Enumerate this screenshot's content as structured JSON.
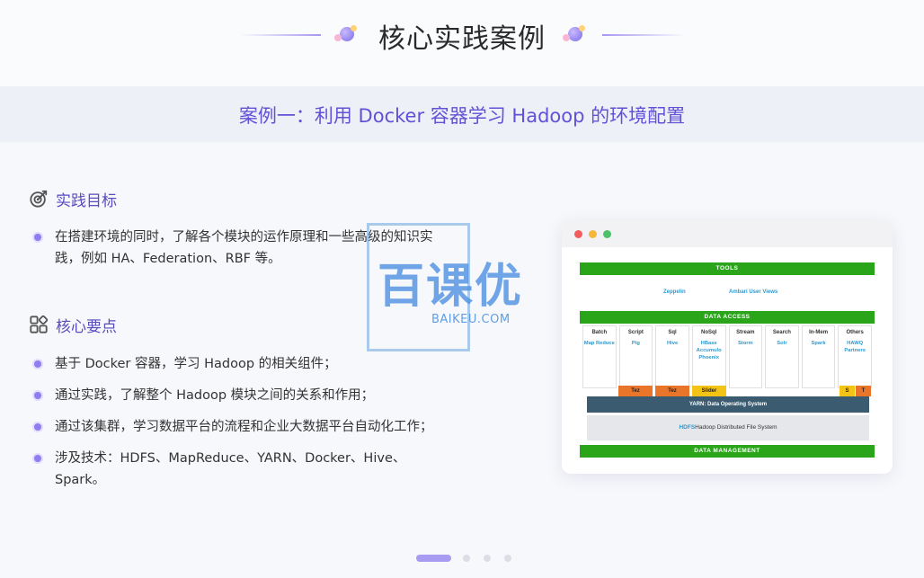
{
  "page": {
    "title": "核心实践案例",
    "subtitle": "案例一：利用 Docker 容器学习 Hadoop 的环境配置"
  },
  "goal_section": {
    "title": "实践目标",
    "icon": "target-icon",
    "items": [
      "在搭建环境的同时，了解各个模块的运作原理和一些高级的知识实践，例如 HA、Federation、RBF 等。"
    ]
  },
  "points_section": {
    "title": "核心要点",
    "icon": "apps-grid-icon",
    "items": [
      "基于 Docker 容器，学习 Hadoop 的相关组件；",
      "通过实践，了解整个 Hadoop 模块之间的关系和作用；",
      "通过该集群，学习数据平台的流程和企业大数据平台自动化工作；",
      "涉及技术：HDFS、MapReduce、YARN、Docker、Hive、Spark。"
    ]
  },
  "watermark": {
    "brand": "百课优",
    "domain": "BAIKEU.COM"
  },
  "diagram": {
    "tools_label": "TOOLS",
    "tools": [
      "Zeppelin",
      "Ambari User Views"
    ],
    "data_access_label": "DATA ACCESS",
    "columns": [
      {
        "head": "Batch",
        "value": "Map Reduce"
      },
      {
        "head": "Script",
        "value": "Pig"
      },
      {
        "head": "Sql",
        "value": "Hive"
      },
      {
        "head": "NoSql",
        "value": "HBase Accumulo Phoenix"
      },
      {
        "head": "Stream",
        "value": "Storm"
      },
      {
        "head": "Search",
        "value": "Solr"
      },
      {
        "head": "In-Mem",
        "value": "Spark"
      },
      {
        "head": "Others",
        "value": "HAWQ Partners"
      }
    ],
    "engines": [
      "Tez",
      "Tez",
      "Slider",
      "S",
      "T"
    ],
    "yarn_label": "YARN: Data Operating System",
    "hdfs_prefix": "HDFS",
    "hdfs_label": "Hadoop Distributed File System",
    "management_label": "DATA MANAGEMENT"
  },
  "pagination": {
    "total": 4,
    "active": 1
  },
  "colors": {
    "accent": "#6450d6",
    "bullet": "#8f7ef0",
    "diagram_green": "#2aa51a",
    "engine_orange": "#e8752a",
    "engine_yellow": "#f3c316",
    "yarn": "#3b5c70"
  }
}
